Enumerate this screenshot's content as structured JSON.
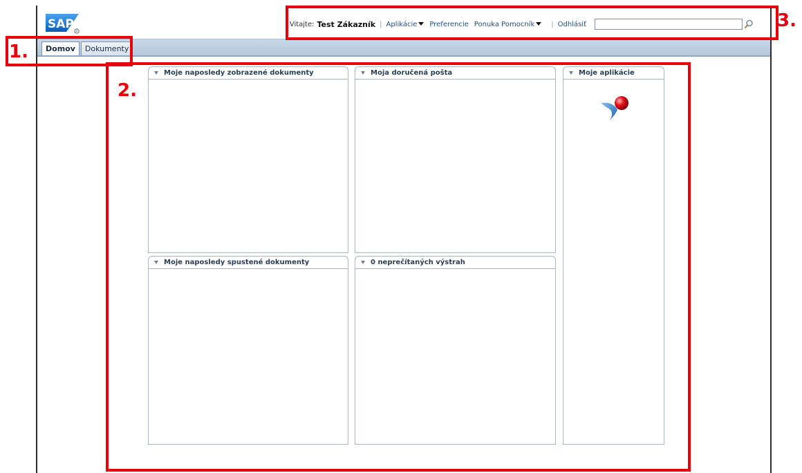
{
  "brand": {
    "logo_text": "SAP"
  },
  "tabs": [
    {
      "label": "Domov",
      "active": true
    },
    {
      "label": "Dokumenty",
      "active": false
    }
  ],
  "topnav": {
    "welcome": "Vitajte:",
    "user": "Test Zákazník",
    "applications": "Aplikácie",
    "preferences": "Preferencie",
    "help_menu": "Ponuka Pomocník",
    "logout": "Odhlásiť",
    "search_value": ""
  },
  "portlets": {
    "recent_viewed": {
      "title": "Moje naposledy zobrazené dokumenty"
    },
    "inbox": {
      "title": "Moja doručená pošta"
    },
    "my_apps": {
      "title": "Moje aplikácie"
    },
    "recent_run": {
      "title": "Moje naposledy spustené dokumenty"
    },
    "alerts": {
      "title": "0 neprečítaných výstrah"
    }
  },
  "annotations": {
    "one": "1.",
    "two": "2.",
    "three": "3."
  },
  "colors": {
    "annotation": "#e8000b",
    "header_bar": "#c9d7e6",
    "sap_blue": "#1a6bc2"
  }
}
